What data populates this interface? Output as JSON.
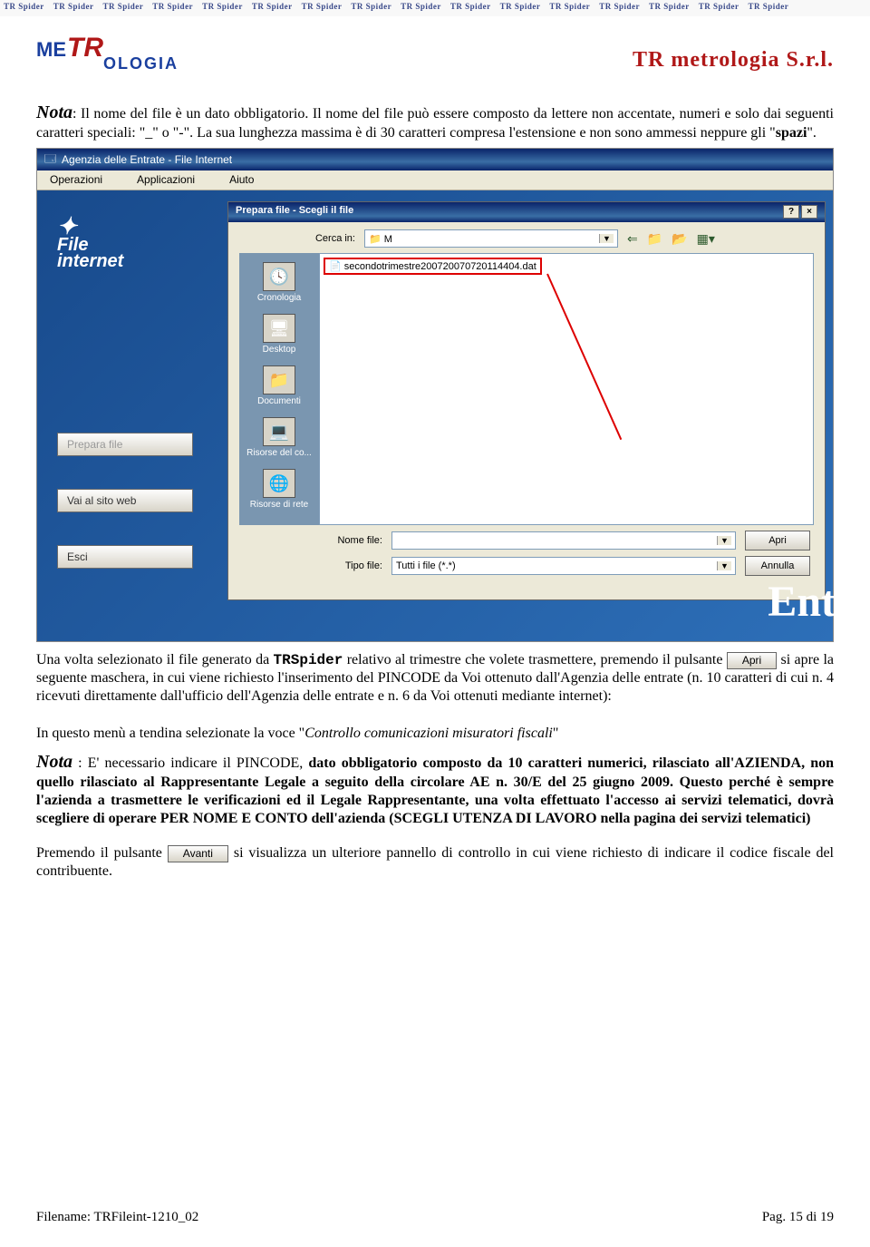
{
  "watermark": "TR Spider",
  "company_header": "TR metrologia S.r.l.",
  "logo": {
    "me": "ME",
    "tr": "TR",
    "ologia": "OLOGIA"
  },
  "nota1": {
    "label": "Nota",
    "text": ":  Il nome del file è un dato obbligatorio. Il nome del file può essere composto da lettere non accentate, numeri e solo dai seguenti caratteri speciali: \"_\" o \"-\". La sua lunghezza massima è di 30 caratteri compresa l'estensione e non sono ammessi neppure gli \"",
    "spazi": "spazi",
    "after": "\"."
  },
  "app": {
    "title": "Agenzia delle Entrate - File Internet",
    "menu": [
      "Operazioni",
      "Applicazioni",
      "Aiuto"
    ],
    "logo_line1": "File",
    "logo_line2": "internet",
    "buttons": {
      "prepara": "Prepara file",
      "vai": "Vai al sito web",
      "esci": "Esci"
    },
    "ent": "Ent"
  },
  "dialog": {
    "title": "Prepara file - Scegli il file",
    "help": "?",
    "close": "×",
    "cerca_label": "Cerca in:",
    "cerca_value": "📁 M",
    "filename": "secondotrimestre200720070720114404.dat",
    "places": [
      {
        "icon": "🕓",
        "label": "Cronologia"
      },
      {
        "icon": "🖥",
        "label": "Desktop"
      },
      {
        "icon": "📁",
        "label": "Documenti"
      },
      {
        "icon": "💻",
        "label": "Risorse del co..."
      },
      {
        "icon": "🌐",
        "label": "Risorse di rete"
      }
    ],
    "nome_label": "Nome file:",
    "nome_value": "",
    "tipo_label": "Tipo file:",
    "tipo_value": "Tutti i file (*.*)",
    "btn_apri": "Apri",
    "btn_annulla": "Annulla"
  },
  "para2": {
    "before": "Una volta selezionato il file generato da ",
    "trspider": "TRSpider",
    "mid1": " relativo al trimestre che volete trasmettere, premendo il pulsante ",
    "btn": "Apri",
    "after": " si apre la seguente maschera, in cui viene richiesto l'inserimento del PINCODE da Voi ottenuto dall'Agenzia delle entrate (n. 10 caratteri di cui n. 4 ricevuti direttamente dall'ufficio dell'Agenzia delle entrate e n. 6 da Voi ottenuti mediante internet):"
  },
  "menu_line": {
    "before": "In questo menù a tendina selezionate la voce \"",
    "italic": "Controllo comunicazioni misuratori fiscali",
    "after": "\""
  },
  "nota2": {
    "label": "Nota",
    "text": " : E' necessario indicare il PINCODE, ",
    "bold": "dato obbligatorio composto da 10 caratteri numerici, rilasciato all'AZIENDA, non quello rilasciato al Rappresentante Legale a seguito della circolare AE n. 30/E del 25 giugno 2009. Questo perché è sempre l'azienda a trasmettere le verificazioni ed il Legale Rappresentante, una volta effettuato l'accesso ai servizi telematici, dovrà scegliere di operare PER NOME E CONTO dell'azienda (SCEGLI UTENZA DI LAVORO nella pagina dei servizi telematici)"
  },
  "para3": {
    "before": "Premendo il pulsante ",
    "btn": "Avanti",
    "after": " si visualizza un ulteriore pannello di controllo in cui viene richiesto di indicare il codice fiscale del contribuente."
  },
  "footer": {
    "filename": "Filename: TRFileint-1210_02",
    "page": "Pag. 15 di 19"
  }
}
